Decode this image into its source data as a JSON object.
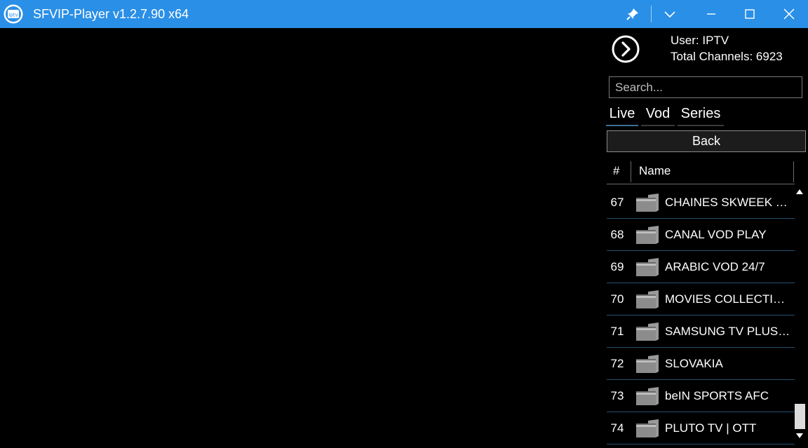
{
  "window": {
    "title": "SFVIP-Player v1.2.7.90 x64",
    "app_icon_text": "iptv",
    "accent": "#2a8fe6"
  },
  "info": {
    "user_label": "User:",
    "user_value": "IPTV",
    "total_label": "Total Channels:",
    "total_value": "6923"
  },
  "search": {
    "placeholder": "Search...",
    "value": ""
  },
  "tabs": [
    {
      "label": "Live",
      "active": true
    },
    {
      "label": "Vod",
      "active": false
    },
    {
      "label": "Series",
      "active": false
    }
  ],
  "back_label": "Back",
  "columns": {
    "num": "#",
    "name": "Name"
  },
  "rows": [
    {
      "num": "67",
      "name": "CHAINES SKWEEK (E..."
    },
    {
      "num": "68",
      "name": "CANAL VOD PLAY"
    },
    {
      "num": "69",
      "name": "ARABIC VOD 24/7"
    },
    {
      "num": "70",
      "name": "MOVIES COLLECTIO..."
    },
    {
      "num": "71",
      "name": "SAMSUNG TV PLUS |..."
    },
    {
      "num": "72",
      "name": "SLOVAKIA"
    },
    {
      "num": "73",
      "name": "beIN SPORTS AFC"
    },
    {
      "num": "74",
      "name": "PLUTO TV | OTT"
    }
  ]
}
